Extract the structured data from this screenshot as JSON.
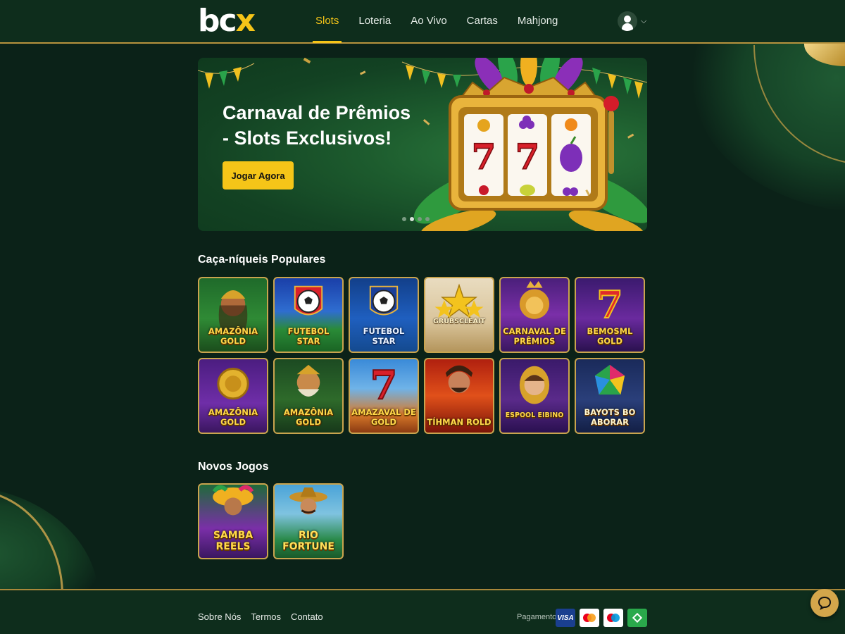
{
  "header": {
    "logo_main": "bc",
    "logo_accent": "x",
    "nav": [
      {
        "label": "Slots",
        "active": true
      },
      {
        "label": "Loteria",
        "active": false
      },
      {
        "label": "Ao Vivo",
        "active": false
      },
      {
        "label": "Cartas",
        "active": false
      },
      {
        "label": "Mahjong",
        "active": false
      }
    ],
    "user_icon": "user-icon",
    "menu_icon": "chevron-down-icon"
  },
  "banner": {
    "title": "Carnaval de Prêmios - Slots Exclusivos!",
    "cta_label": "Jogar Agora",
    "carousel_slides": 4,
    "active_slide": 2
  },
  "sections": {
    "popular_title": "Caça-níqueis Populares",
    "new_title": "Novos Jogos"
  },
  "popular_games": [
    {
      "name": "AMAZÔNIA GOLD"
    },
    {
      "name": "FUTEBOL STAR"
    },
    {
      "name": "FUTEBOL STAR"
    },
    {
      "name": "GRUBSCLEAIT"
    },
    {
      "name": "CARNAVAL DE PRÊMIOS"
    },
    {
      "name": "BEMOSML GOLD"
    },
    {
      "name": "AMAZÔNIA GOLD"
    },
    {
      "name": "AMAZÔNIA GOLD"
    },
    {
      "name": "AMAZAVAL DE GOLD"
    },
    {
      "name": "TÍHMAN ROLD"
    },
    {
      "name": "ESPOOL EIBINO"
    },
    {
      "name": "BAYOTS BO ABORAR"
    }
  ],
  "new_games": [
    {
      "name": "SAMBA REELS"
    },
    {
      "name": "RIO FORTUNE"
    }
  ],
  "footer": {
    "links": [
      "Sobre Nós",
      "Termos",
      "Contato"
    ],
    "payment_label": "Pagamento",
    "payments": [
      "VISA",
      "mastercard",
      "maestro",
      "pix"
    ]
  },
  "colors": {
    "background": "#0b2218",
    "header": "#0e2d1c",
    "accent_yellow": "#f5c518",
    "gold_border": "#c9a44e"
  }
}
